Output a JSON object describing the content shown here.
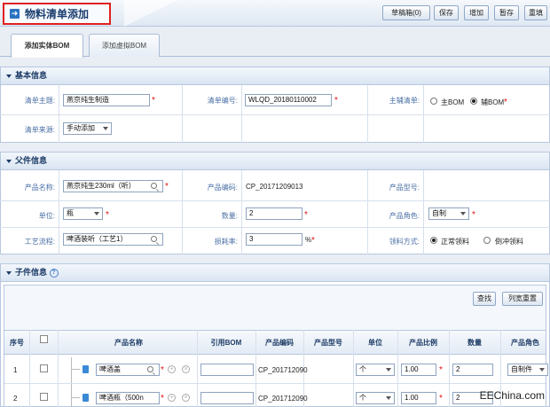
{
  "header": {
    "title": "物料清单添加",
    "buttons": [
      "草稿箱(0)",
      "保存",
      "增加",
      "暂存",
      "重填"
    ]
  },
  "tabs": [
    "添加实体BOM",
    "添加虚拟BOM"
  ],
  "basic": {
    "section": "基本信息",
    "subject_label": "清单主题:",
    "subject_value": "燕京纯生制造",
    "code_label": "清单编号:",
    "code_value": "WLQD_20180110002",
    "main_label": "主辅清单:",
    "opt_main": "主BOM",
    "opt_aux": "辅BOM",
    "source_label": "清单来源:",
    "source_value": "手动添加"
  },
  "parent": {
    "section": "父件信息",
    "pname_label": "产品名称:",
    "pname_value": "燕京纯生230ml（听）",
    "pcode_label": "产品编码:",
    "pcode_value": "CP_20171209013",
    "pmodel_label": "产品型号:",
    "unit_label": "单位:",
    "unit_value": "瓶",
    "qty_label": "数量:",
    "qty_value": "2",
    "role_label": "产品角色:",
    "role_value": "自制",
    "process_label": "工艺流程:",
    "process_value": "啤酒装听（工艺1）",
    "loss_label": "损耗率:",
    "loss_value": "3",
    "loss_unit": "%",
    "pick_label": "领料方式:",
    "pick_normal": "正常领料",
    "pick_backflush": "倒冲领料"
  },
  "child": {
    "section": "子件信息",
    "search_btn": "查找",
    "reset_btn": "列宽重置",
    "columns": [
      "序号",
      "",
      "产品名称",
      "引用BOM",
      "产品编码",
      "产品型号",
      "单位",
      "产品比例",
      "数量",
      "产品角色"
    ],
    "rows": [
      {
        "no": "1",
        "name": "啤酒盖",
        "code": "CP_2017120​90",
        "unit": "个",
        "ratio": "1.00",
        "qty": "2",
        "role": "自制件"
      },
      {
        "no": "2",
        "name": "啤酒瓶（500n",
        "code": "CP_2017120​90",
        "unit": "个",
        "ratio": "1.00",
        "qty": "2",
        "role": "自制件"
      }
    ]
  },
  "watermark": "EEChina.com"
}
